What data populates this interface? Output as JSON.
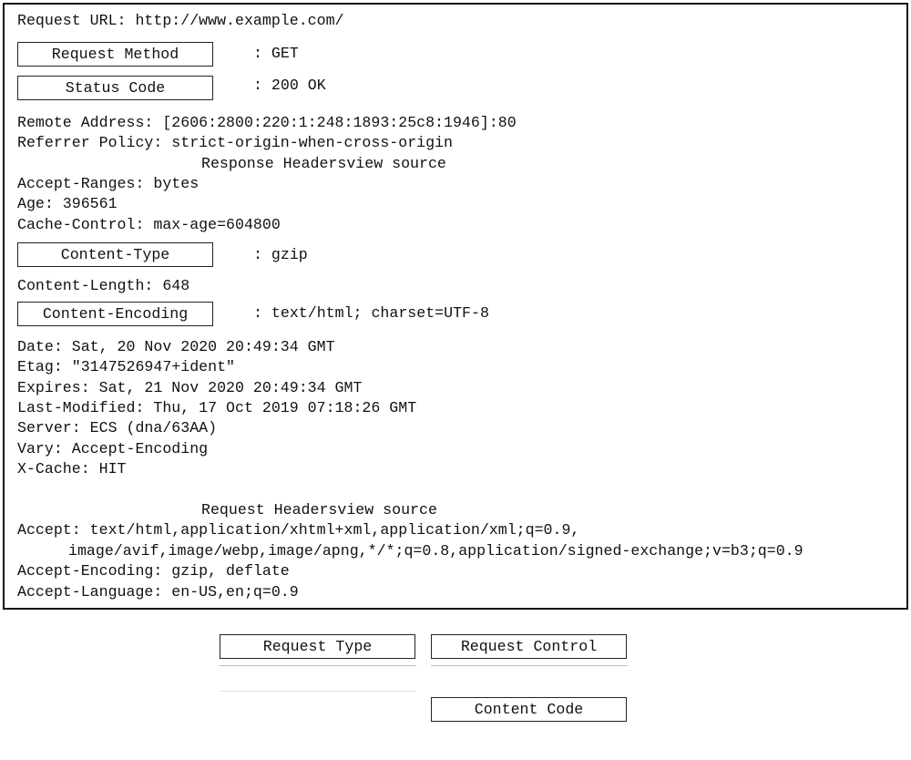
{
  "headers": {
    "request_url": "Request URL: http://www.example.com/",
    "request_method_box": "Request Method",
    "request_method_value": ": GET",
    "status_code_box": "Status Code",
    "status_code_value": ": 200 OK",
    "remote_address": "Remote Address: [2606:2800:220:1:248:1893:25c8:1946]:80",
    "referrer_policy": "Referrer Policy: strict-origin-when-cross-origin",
    "response_headers_title": "Response Headersview source",
    "accept_ranges": "Accept-Ranges: bytes",
    "age": "Age: 396561",
    "cache_control": "Cache-Control: max-age=604800",
    "content_type_box": "Content-Type",
    "content_type_value": ": gzip",
    "content_length": "Content-Length: 648",
    "content_encoding_box": "Content-Encoding",
    "content_encoding_value": ": text/html; charset=UTF-8",
    "date": "Date: Sat, 20 Nov 2020 20:49:34 GMT",
    "etag": "Etag: \"3147526947+ident\"",
    "expires": "Expires: Sat, 21 Nov 2020 20:49:34 GMT",
    "last_modified": "Last-Modified: Thu, 17 Oct 2019 07:18:26 GMT",
    "server": "Server: ECS (dna/63AA)",
    "vary": "Vary: Accept-Encoding",
    "x_cache": "X-Cache: HIT",
    "request_headers_title": "Request Headersview source",
    "accept_line1": "Accept: text/html,application/xhtml+xml,application/xml;q=0.9,",
    "accept_line2": "image/avif,image/webp,image/apng,*/*;q=0.8,application/signed-exchange;v=b3;q=0.9",
    "accept_encoding": "Accept-Encoding: gzip, deflate",
    "accept_language": "Accept-Language: en-US,en;q=0.9"
  },
  "options": {
    "request_type": "Request Type",
    "request_control": "Request Control",
    "content_code": "Content Code"
  }
}
